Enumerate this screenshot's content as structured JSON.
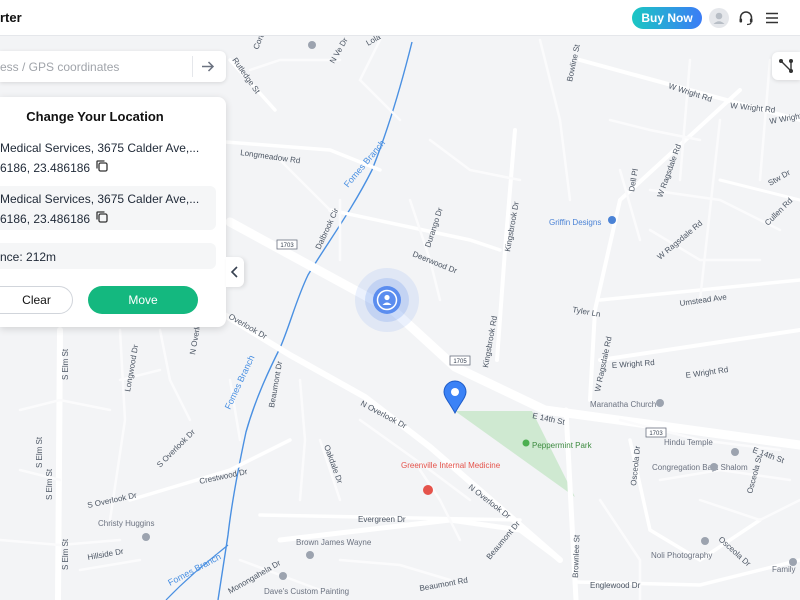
{
  "app": {
    "title": "rter"
  },
  "header": {
    "buy_now_label": "Buy Now",
    "icons": [
      "user-avatar-icon",
      "headset-icon",
      "hamburger-menu-icon"
    ]
  },
  "search": {
    "placeholder": "ess / GPS coordinates",
    "go_icon": "arrow-right-icon"
  },
  "route_icon": "route-icon",
  "panel": {
    "title": "Change Your Location",
    "origin": {
      "name": "Medical Services, 3675 Calder Ave,...",
      "coords": "6186,  23.486186"
    },
    "destination": {
      "name": "Medical Services, 3675 Calder Ave,...",
      "coords": "6186,  23.486186"
    },
    "distance": "nce: 212m",
    "clear_label": "Clear",
    "move_label": "Move",
    "collapse_icon": "chevron-left-icon"
  },
  "map": {
    "colors": {
      "water": "#4a90e2",
      "park": "#cfe9d1",
      "pin": "#3b82f6",
      "current": "#5b8def",
      "medical": "#e5534b",
      "move": "#14b87f"
    },
    "roads": [
      "Rutledge St",
      "Cortez Dr",
      "N Ve Dr",
      "Lola",
      "Longmeadow Rd",
      "W Wright Rd",
      "W Wright Rd",
      "Bowline St",
      "W Wright Rd",
      "Dalbrook Cir",
      "Durango Dr",
      "Deerwood Dr",
      "Kingsbrook Dr",
      "Dell Pl",
      "W Ragsdale Rd",
      "Stw Dr",
      "Cullen Rd",
      "W Ragsdale Rd",
      "Umstead Ave",
      "Tyler Ln",
      "Kingsbrook Rd",
      "Overlook Dr",
      "N Overlook Dr",
      "W Ragsdale Rd",
      "E Wright Rd",
      "E Wright Rd",
      "E 14th St",
      "E 14th St",
      "Longwood Dr",
      "S Elm St",
      "S Elm St",
      "S Elm St",
      "S Elm St",
      "Beaumont Dr",
      "N Overlook Dr",
      "S Overlook Dr",
      "Crestwood Dr",
      "Oakdale Dr",
      "N Overlook Dr",
      "Evergreen Dr",
      "Hillside Dr",
      "Monongahela Dr",
      "Beaumont Dr",
      "Beaumont Rd",
      "Brownlee St",
      "Englewood Dr",
      "Osceola Dr",
      "Osceola Dr",
      "Osceola St",
      "Fomes Branch",
      "Fomes Branch",
      "Fomes Branch",
      "S Overlook Dr"
    ],
    "shields": [
      "1703",
      "1705",
      "1703"
    ],
    "pois": [
      "Griffin Designs",
      "Peppermint Park",
      "Maranatha Church",
      "Hindu Temple",
      "Congregation Bayt Shalom",
      "Greenville Internal Medicine",
      "Christy Huggins",
      "Brown James Wayne",
      "Noli Photography",
      "Dave's Custom Painting",
      "Family"
    ]
  }
}
